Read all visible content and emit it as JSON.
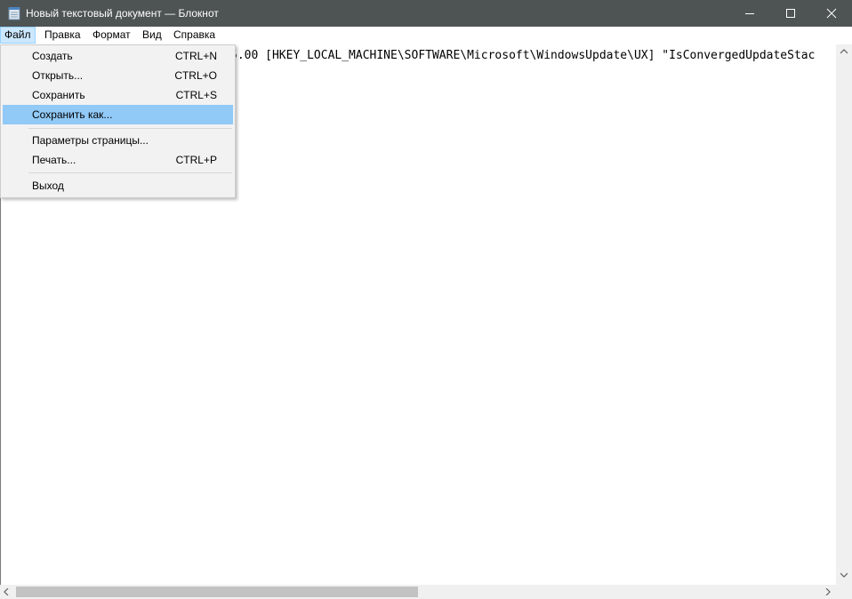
{
  "window": {
    "title": "Новый текстовый документ — Блокнот"
  },
  "menubar": {
    "items": [
      "Файл",
      "Правка",
      "Формат",
      "Вид",
      "Справка"
    ]
  },
  "editor": {
    "visible_text": "5.00 [HKEY_LOCAL_MACHINE\\SOFTWARE\\Microsoft\\WindowsUpdate\\UX] \"IsConvergedUpdateStac"
  },
  "file_menu": {
    "items": [
      {
        "label": "Создать",
        "shortcut": "CTRL+N"
      },
      {
        "label": "Открыть...",
        "shortcut": "CTRL+O"
      },
      {
        "label": "Сохранить",
        "shortcut": "CTRL+S"
      },
      {
        "label": "Сохранить как...",
        "shortcut": ""
      },
      {
        "label": "Параметры страницы...",
        "shortcut": ""
      },
      {
        "label": "Печать...",
        "shortcut": "CTRL+P"
      },
      {
        "label": "Выход",
        "shortcut": ""
      }
    ],
    "highlighted": "Сохранить как..."
  },
  "colors": {
    "titlebar": "#4e5354",
    "highlight": "#91c9f7",
    "menu_open": "#cce8ff"
  }
}
